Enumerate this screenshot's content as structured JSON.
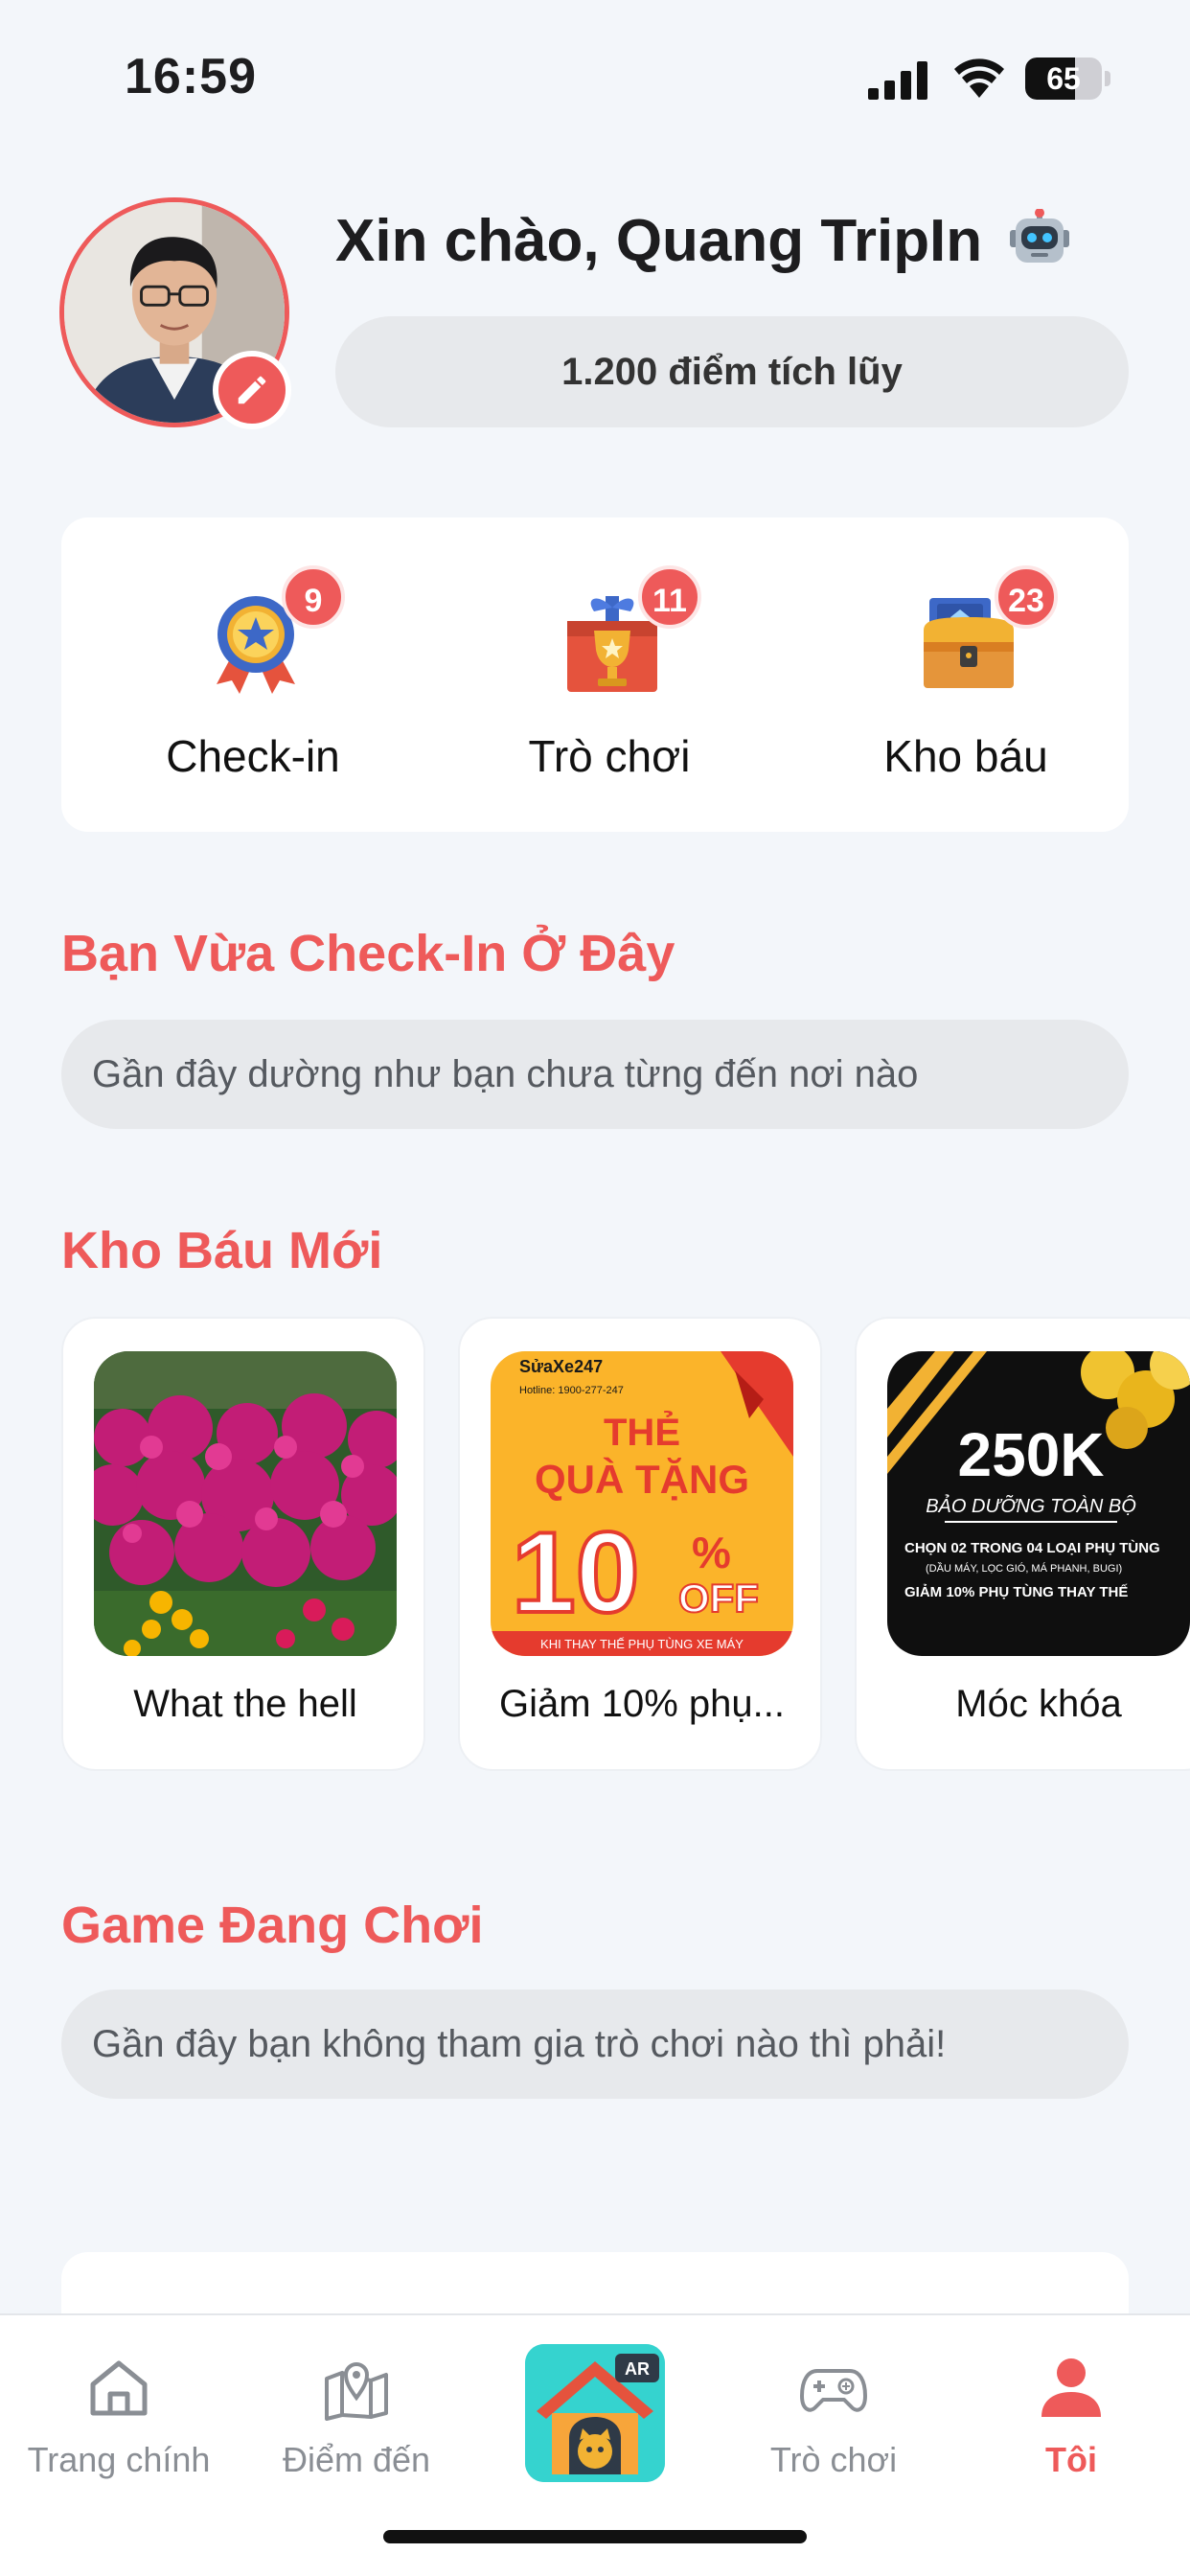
{
  "status_bar": {
    "time": "16:59",
    "battery": "65",
    "battery_level": 0.65
  },
  "profile": {
    "greeting": "Xin chào, Quang TripIn",
    "points": "1.200 điểm tích lũy"
  },
  "quick_actions": [
    {
      "label": "Check-in",
      "badge": "9",
      "icon": "medal-icon"
    },
    {
      "label": "Trò chơi",
      "badge": "11",
      "icon": "trophy-gift-icon"
    },
    {
      "label": "Kho báu",
      "badge": "23",
      "icon": "treasure-chest-icon"
    }
  ],
  "checkin_section": {
    "title": "Bạn Vừa Check-In Ở Đây",
    "empty_text": "Gần đây dường như bạn chưa từng đến nơi nào"
  },
  "treasure_section": {
    "title": "Kho Báu Mới",
    "items": [
      {
        "label": "What the hell"
      },
      {
        "label": "Giảm 10% phụ...",
        "brand": "SửaXe247",
        "hotline": "Hotline: 1900-277-247",
        "title1": "THẺ",
        "title2": "QUÀ TẶNG",
        "discount": "10",
        "percent": "%",
        "off": "OFF",
        "footer": "KHI THAY THẾ PHỤ TÙNG XE MÁY"
      },
      {
        "label": "Móc khóa",
        "amount": "250K",
        "subtitle": "BẢO DƯỠNG TOÀN BỘ",
        "line1": "CHỌN 02 TRONG 04 LOẠI PHỤ TÙNG",
        "line1b": "(DẦU MÁY, LỌC GIÓ, MÁ PHANH, BUGI)",
        "line2": "GIẢM 10% PHỤ TÙNG THAY THẾ"
      }
    ]
  },
  "game_section": {
    "title": "Game Đang Chơi",
    "empty_text": "Gần đây bạn không tham gia trò chơi nào thì phải!"
  },
  "tab_bar": {
    "tabs": [
      {
        "label": "Trang chính",
        "icon": "home-icon"
      },
      {
        "label": "Điểm đến",
        "icon": "map-pin-icon"
      },
      {
        "label": "Trò chơi",
        "icon": "gamepad-icon"
      },
      {
        "label": "Tôi",
        "icon": "user-icon",
        "active": true
      }
    ],
    "ar_badge": "AR"
  },
  "colors": {
    "accent": "#ee5a5a",
    "background": "#f3f6fa",
    "ar_teal": "#35d3cf"
  }
}
